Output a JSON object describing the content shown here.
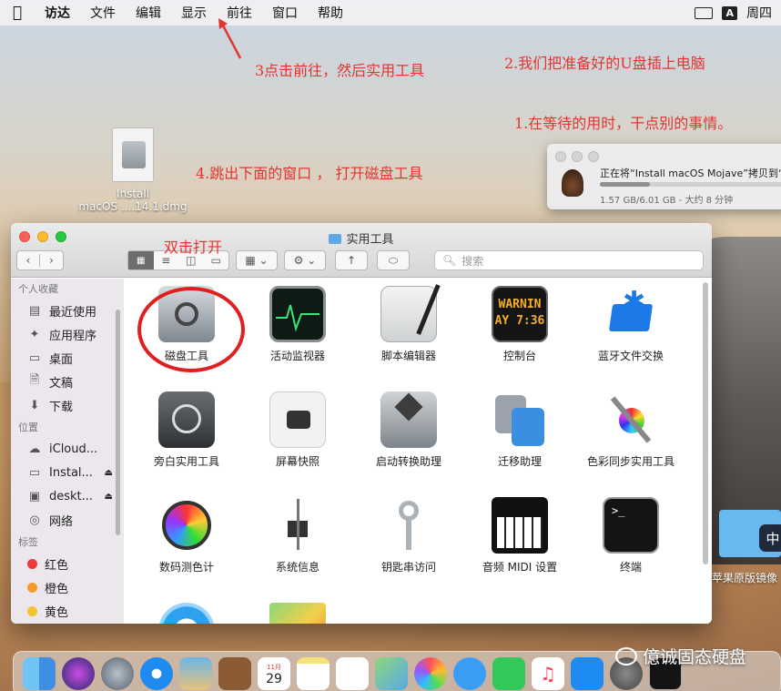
{
  "menubar": {
    "apple": "",
    "items": [
      "访达",
      "文件",
      "编辑",
      "显示",
      "前往",
      "窗口",
      "帮助"
    ],
    "input_badge": "A",
    "clock": "周四"
  },
  "annotations": {
    "step3": "3点击前往，然后实用工具",
    "step2": "2.我们把准备好的U盘插上电脑",
    "step1": "1.在等待的用时，干点别的事情。",
    "step4": "4.跳出下面的窗口 ， 打开磁盘工具",
    "double_click": "双击打开"
  },
  "desktop": {
    "dmg_label_1": "Install",
    "dmg_label_2": "macOS ....14.1.dmg",
    "folder_label": "苹果原版镜像",
    "ime_badge": "中"
  },
  "copy_dialog": {
    "text": "正在将“Install macOS Mojave”拷贝到“",
    "progress": 0.26,
    "status": "1.57 GB/6.01 GB - 大约 8 分钟"
  },
  "finder": {
    "title": "实用工具",
    "search_placeholder": "搜索",
    "sidebar": {
      "section_favorites": "个人收藏",
      "favorites": [
        "最近使用",
        "应用程序",
        "桌面",
        "文稿",
        "下载"
      ],
      "section_locations": "位置",
      "locations": [
        "iCloud...",
        "Instal...",
        "deskt...",
        "网络"
      ],
      "section_tags": "标签",
      "tags": [
        {
          "label": "红色",
          "color": "#ec3b3b"
        },
        {
          "label": "橙色",
          "color": "#f39a2c"
        },
        {
          "label": "黄色",
          "color": "#f2c530"
        }
      ]
    },
    "apps": [
      "磁盘工具",
      "活动监视器",
      "脚本编辑器",
      "控制台",
      "蓝牙文件交换",
      "旁白实用工具",
      "屏幕快照",
      "启动转换助理",
      "迁移助理",
      "色彩同步实用工具",
      "数码测色计",
      "系统信息",
      "钥匙串访问",
      "音频 MIDI 设置",
      "终端"
    ],
    "console_text_1": "WARNIN",
    "console_text_2": "AY 7:36"
  },
  "dock": {
    "calendar_day": "29",
    "calendar_month": "11月"
  },
  "watermark": "億诚固态硬盘"
}
